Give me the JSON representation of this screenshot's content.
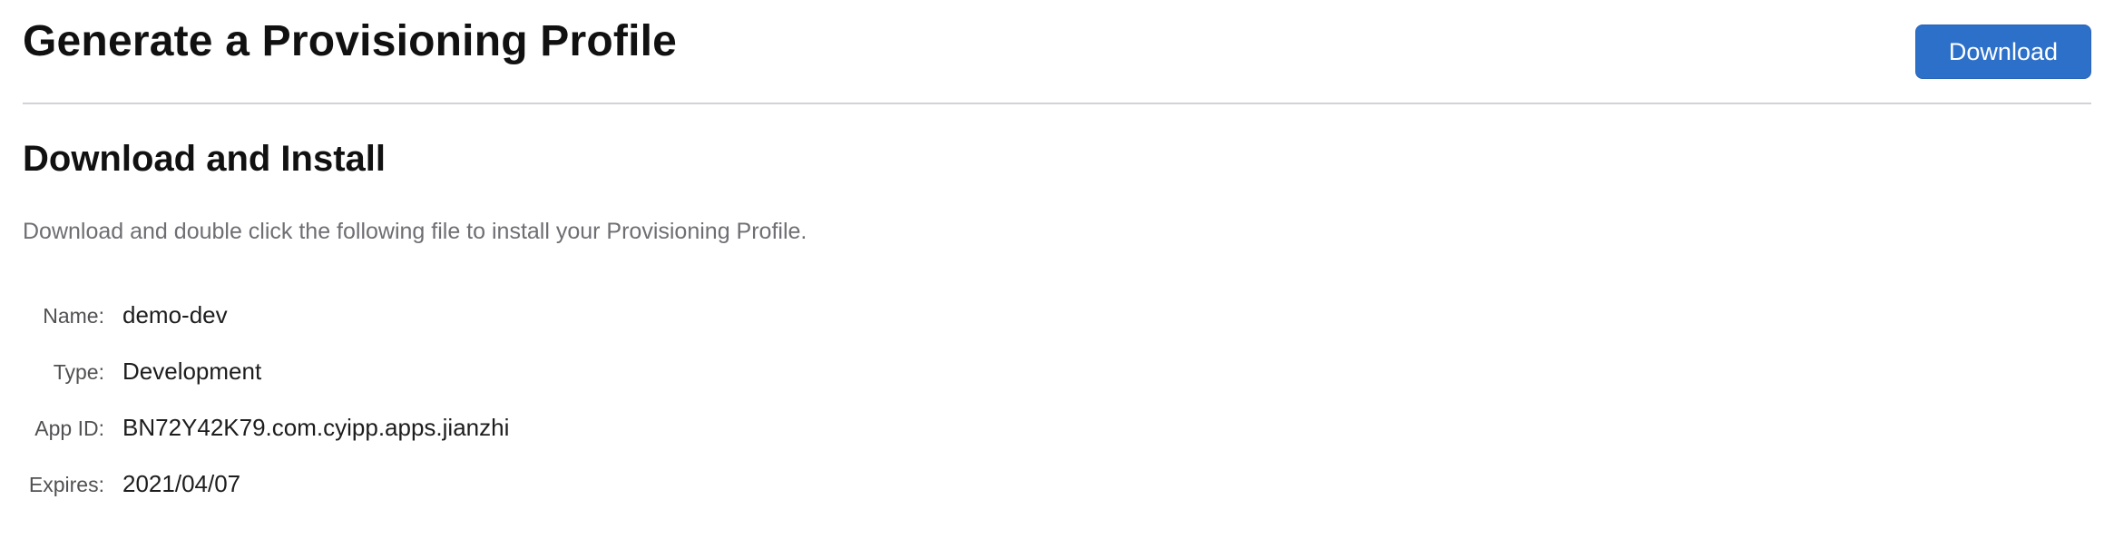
{
  "header": {
    "title": "Generate a Provisioning Profile",
    "download_label": "Download"
  },
  "section": {
    "heading": "Download and Install",
    "description": "Download and double click the following file to install your Provisioning Profile."
  },
  "profile_details": [
    {
      "label": "Name:",
      "value": "demo-dev"
    },
    {
      "label": "Type:",
      "value": "Development"
    },
    {
      "label": "App ID:",
      "value": "BN72Y42K79.com.cyipp.apps.jianzhi"
    },
    {
      "label": "Expires:",
      "value": "2021/04/07"
    }
  ],
  "colors": {
    "accent": "#2d70c9",
    "divider": "#d2d2d7",
    "muted_text": "#6e6e73"
  }
}
